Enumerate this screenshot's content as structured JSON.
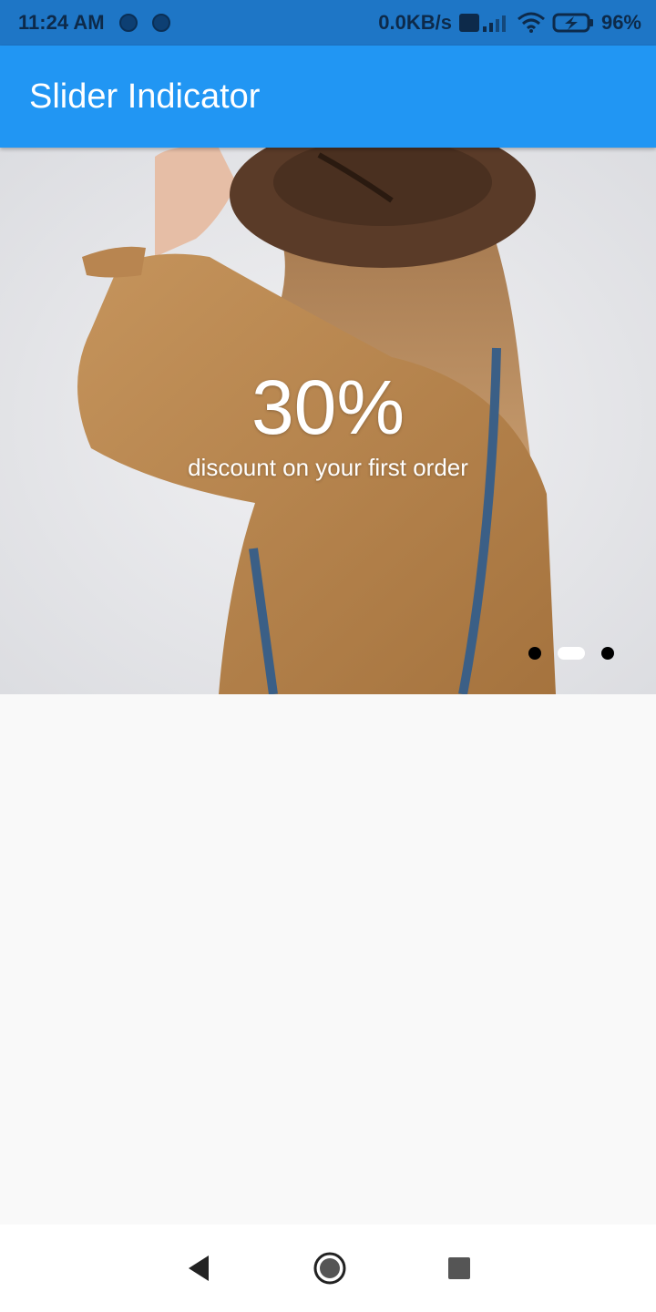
{
  "status_bar": {
    "time": "11:24 AM",
    "speed": "0.0KB/s",
    "network": "VoLTE",
    "battery": "96%"
  },
  "app_bar": {
    "title": "Slider Indicator"
  },
  "slider": {
    "headline": "30%",
    "subline": "discount on your first order",
    "indicator_count": 3,
    "active_index": 1
  },
  "nav": {
    "back_icon": "back-icon",
    "home_icon": "home-icon",
    "recents_icon": "recents-icon"
  },
  "colors": {
    "primary": "#2196f3",
    "status": "#1e76c6",
    "background": "#f9f9f9"
  }
}
